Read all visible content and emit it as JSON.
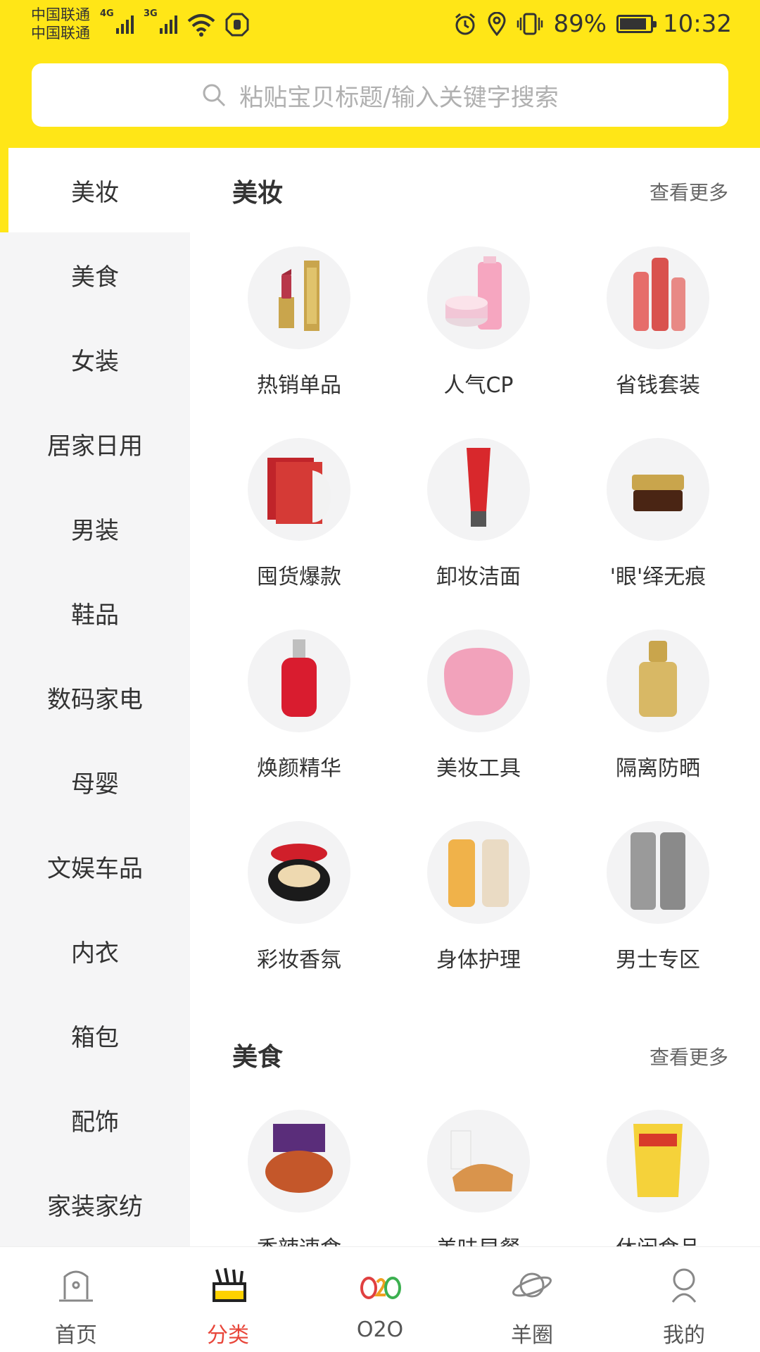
{
  "status_bar": {
    "carrier_1": "中国联通",
    "carrier_2": "中国联通",
    "net_1": "4G",
    "net_2": "3G",
    "battery_percent": "89%",
    "battery_level": 0.89,
    "time": "10:32"
  },
  "search": {
    "placeholder": "粘贴宝贝标题/输入关键字搜索"
  },
  "sidebar": {
    "items": [
      {
        "label": "美妆",
        "active": true
      },
      {
        "label": "美食"
      },
      {
        "label": "女装"
      },
      {
        "label": "居家日用"
      },
      {
        "label": "男装"
      },
      {
        "label": "鞋品"
      },
      {
        "label": "数码家电"
      },
      {
        "label": "母婴"
      },
      {
        "label": "文娱车品"
      },
      {
        "label": "内衣"
      },
      {
        "label": "箱包"
      },
      {
        "label": "配饰"
      },
      {
        "label": "家装家纺"
      }
    ]
  },
  "sections": [
    {
      "title": "美妆",
      "more": "查看更多",
      "items": [
        "热销单品",
        "人气CP",
        "省钱套装",
        "囤货爆款",
        "卸妆洁面",
        "'眼'绎无痕",
        "焕颜精华",
        "美妆工具",
        "隔离防晒",
        "彩妆香氛",
        "身体护理",
        "男士专区"
      ]
    },
    {
      "title": "美食",
      "more": "查看更多",
      "items": [
        "香辣速食",
        "美味早餐",
        "休闲食品"
      ]
    }
  ],
  "tabbar": {
    "items": [
      {
        "label": "首页"
      },
      {
        "label": "分类",
        "active": true
      },
      {
        "label": "O2O"
      },
      {
        "label": "羊圈"
      },
      {
        "label": "我的"
      }
    ]
  },
  "colors": {
    "brand_yellow": "#FFE617",
    "active_tab_red": "#E8463A",
    "sidebar_bg": "#F5F5F6"
  }
}
